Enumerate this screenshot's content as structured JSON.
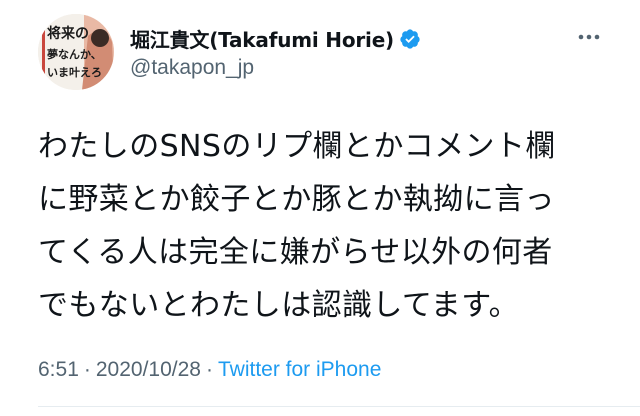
{
  "author": {
    "display_name": "堀江貴文(Takafumi Horie)",
    "handle": "@takapon_jp",
    "verified": true,
    "avatar_text": [
      "将来の",
      "夢なんか、",
      "いま叶えろ"
    ]
  },
  "tweet": {
    "text_lines": [
      "わたしのSNSのリプ欄とかコメント欄",
      "に野菜とか餃子とか豚とか執拗に言っ",
      "てくる人は完全に嫌がらせ以外の何者",
      "でもないとわたしは認識してます。"
    ],
    "time": "6:51",
    "separator": "·",
    "date": "2020/10/28",
    "source": "Twitter for iPhone"
  },
  "colors": {
    "text": "#0f1419",
    "secondary": "#536471",
    "accent": "#1d9bf0",
    "divider": "#e6ecf0"
  },
  "icons": {
    "verified": "verified-badge-icon",
    "more": "more-options-icon"
  }
}
